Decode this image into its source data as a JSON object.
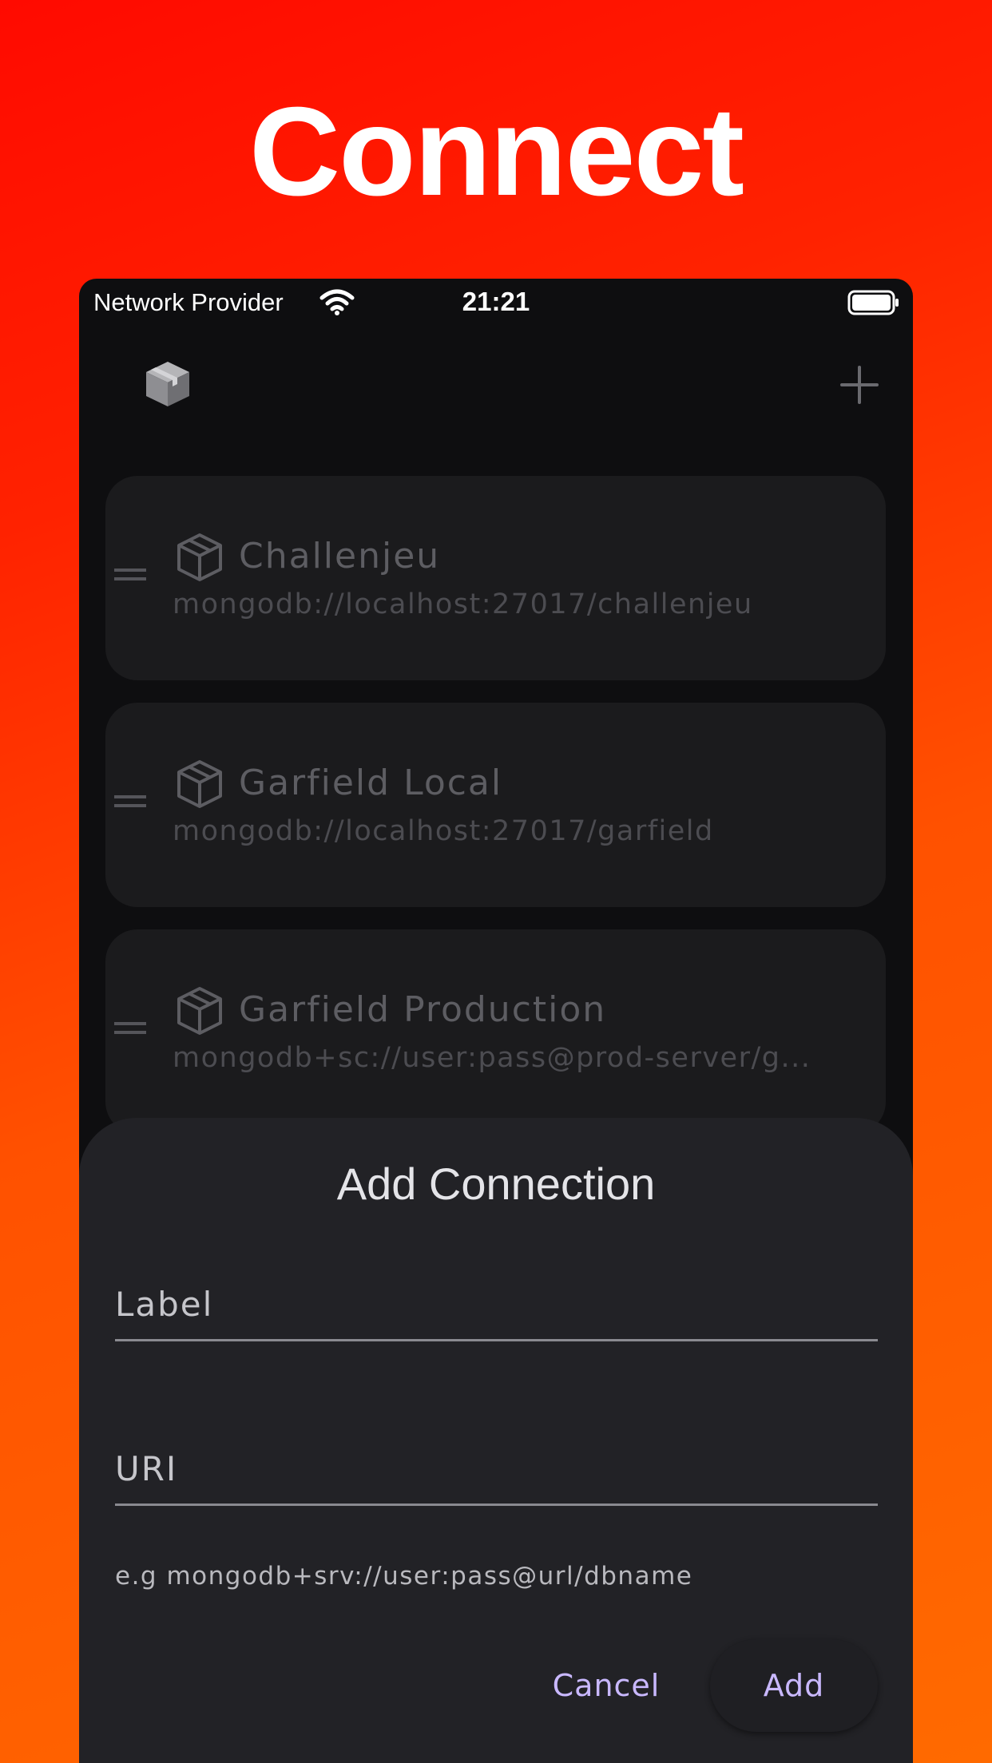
{
  "headline": "Connect",
  "status_bar": {
    "carrier": "Network Provider",
    "time": "21:21"
  },
  "toolbar": {
    "logo_icon": "package-icon",
    "add_icon": "plus-icon"
  },
  "connections": [
    {
      "label": "Challenjeu",
      "uri": "mongodb://localhost:27017/challenjeu"
    },
    {
      "label": "Garfield Local",
      "uri": "mongodb://localhost:27017/garfield"
    },
    {
      "label": "Garfield Production",
      "uri": "mongodb+sc://user:pass@prod-server/g..."
    }
  ],
  "dialog": {
    "title": "Add Connection",
    "label_field": {
      "label": "Label",
      "value": ""
    },
    "uri_field": {
      "label": "URI",
      "value": ""
    },
    "hint": "e.g mongodb+srv://user:pass@url/dbname",
    "cancel_label": "Cancel",
    "add_label": "Add"
  },
  "colors": {
    "background_top": "#ff0a00",
    "background_bottom": "#ff6a00",
    "sheet": "#222226",
    "accent": "#c9b8ff"
  }
}
